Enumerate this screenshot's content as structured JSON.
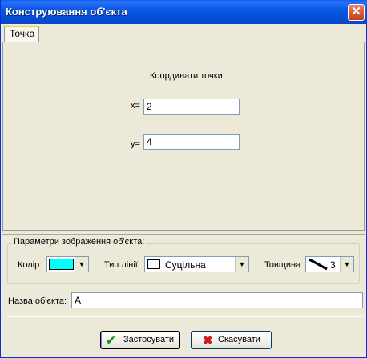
{
  "window": {
    "title": "Конструювання об'єкта",
    "close_glyph": "✕"
  },
  "tabs": [
    {
      "label": "Точка"
    }
  ],
  "point": {
    "heading": "Координати точки:",
    "x_label": "x=",
    "x_value": "2",
    "y_label": "y=",
    "y_value": "4"
  },
  "display_params": {
    "caption": "Параметри зображення об'єкта:",
    "color_label": "Колір:",
    "color_value": "#00ffff",
    "line_type_label": "Тип лінії:",
    "line_type_value": "Суцільна",
    "thickness_label": "Товщина:",
    "thickness_value": "3"
  },
  "name": {
    "label": "Назва об'єкта:",
    "value": "A"
  },
  "buttons": {
    "apply_label": "Застосувати",
    "apply_icon": "checkmark-icon",
    "cancel_label": "Скасувати",
    "cancel_icon": "x-icon"
  }
}
